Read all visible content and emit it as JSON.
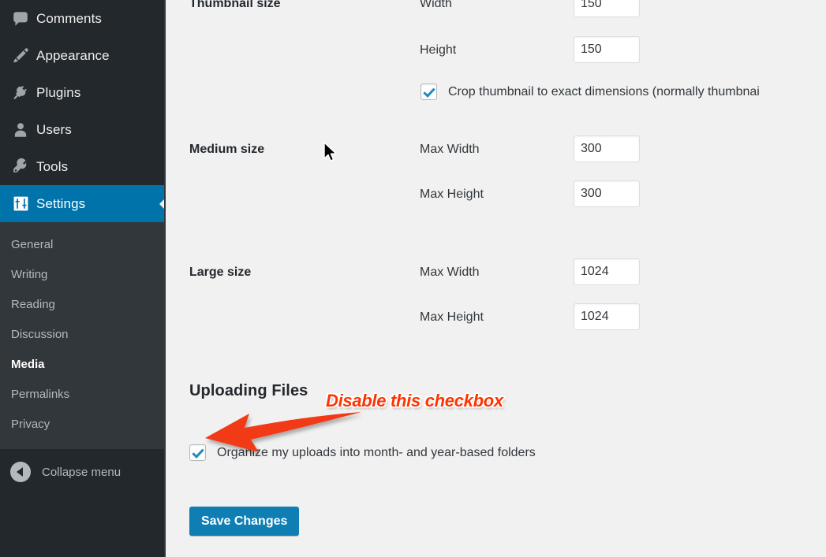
{
  "sidebar": {
    "menu_items": [
      {
        "label": "Comments",
        "icon": "comments-icon",
        "current": false
      },
      {
        "label": "Appearance",
        "icon": "appearance-brush-icon",
        "current": false
      },
      {
        "label": "Plugins",
        "icon": "plugins-plug-icon",
        "current": false
      },
      {
        "label": "Users",
        "icon": "users-person-icon",
        "current": false
      },
      {
        "label": "Tools",
        "icon": "tools-wrench-icon",
        "current": false
      },
      {
        "label": "Settings",
        "icon": "settings-sliders-icon",
        "current": true
      }
    ],
    "submenu_items": [
      {
        "label": "General",
        "current": false
      },
      {
        "label": "Writing",
        "current": false
      },
      {
        "label": "Reading",
        "current": false
      },
      {
        "label": "Discussion",
        "current": false
      },
      {
        "label": "Media",
        "current": true
      },
      {
        "label": "Permalinks",
        "current": false
      },
      {
        "label": "Privacy",
        "current": false
      }
    ],
    "collapse": {
      "label": "Collapse menu",
      "icon": "collapse-arrow-left-icon"
    }
  },
  "main": {
    "thumbnail": {
      "title": "Thumbnail size",
      "width_label": "Width",
      "width_value": "150",
      "height_label": "Height",
      "height_value": "150",
      "crop_label": "Crop thumbnail to exact dimensions (normally thumbnai",
      "crop_checked": true
    },
    "medium": {
      "title": "Medium size",
      "max_width_label": "Max Width",
      "max_width_value": "300",
      "max_height_label": "Max Height",
      "max_height_value": "300"
    },
    "large": {
      "title": "Large size",
      "max_width_label": "Max Width",
      "max_width_value": "1024",
      "max_height_label": "Max Height",
      "max_height_value": "1024"
    },
    "uploading": {
      "heading": "Uploading Files",
      "organize_label": "Organize my uploads into month- and year-based folders",
      "organize_checked": true
    },
    "save_label": "Save Changes"
  },
  "annotation": {
    "text": "Disable this checkbox",
    "color": "#ff3300",
    "arrow": "red-arrow-pointing-left-down"
  },
  "colors": {
    "sidebar_bg": "#23282d",
    "submenu_bg": "#32373c",
    "active_blue": "#0073aa",
    "content_bg": "#f1f1f1",
    "button_blue": "#0e7eb3",
    "checkbox_blue": "#1e8cbe"
  }
}
